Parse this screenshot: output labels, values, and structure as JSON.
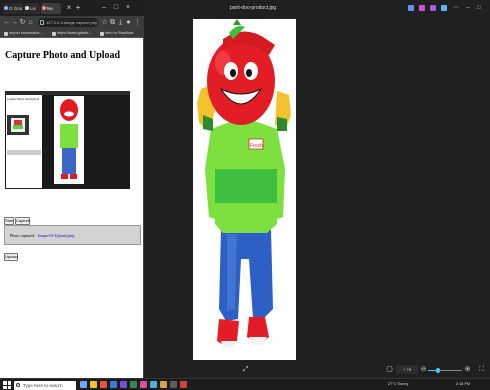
{
  "browser": {
    "tabs": [
      {
        "label": "G Goo"
      },
      {
        "label": "Lis"
      },
      {
        "label": "Ne"
      }
    ],
    "address_text": "127.0.0.1/Image capture.php",
    "bookmarks": [
      {
        "label": "Import bookmarks..."
      },
      {
        "label": "https://www.gstatic..."
      },
      {
        "label": "Intro to Rankflow"
      }
    ]
  },
  "page": {
    "title": "Capture Photo and Upload",
    "preview_title": "Capture Photo and Upload",
    "buttons": {
      "start": "Start",
      "capture": "Capture",
      "upload": "Upload"
    },
    "status_label": "Photo captured:",
    "status_value": "Image-01-Upload.jpeg"
  },
  "viewer": {
    "title": "pant-doo-product.jpg",
    "zoom_value": "+ 78",
    "zoom_fraction": 0.28,
    "top_icons": [
      {
        "name": "add-to-album-icon",
        "color": "#6a8cff"
      },
      {
        "name": "edit-icon",
        "color": "#d04fd0"
      },
      {
        "name": "share-icon",
        "color": "#a35cf0"
      },
      {
        "name": "info-icon",
        "color": "#5fb0ff"
      },
      {
        "name": "more-icon",
        "color": "#888888"
      }
    ],
    "photo": {
      "caption": "Fresh"
    }
  },
  "taskbar": {
    "search_placeholder": "Type here to search",
    "tray_text": "27°C Sunny",
    "clock": "2:18 PM"
  }
}
